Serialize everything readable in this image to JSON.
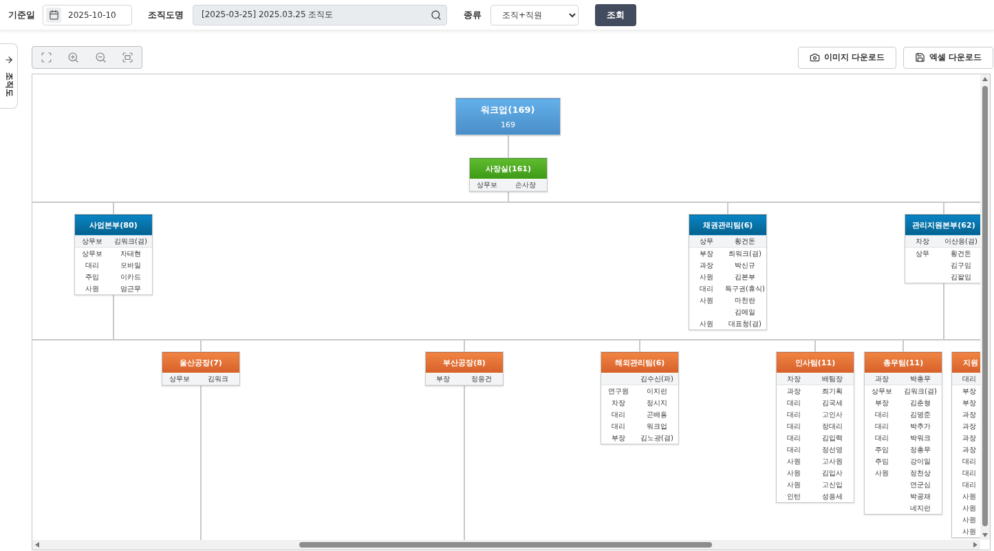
{
  "filters": {
    "date": {
      "label": "기준일",
      "value": "2025-10-10"
    },
    "chart_name": {
      "label": "조직도명",
      "value": "[2025-03-25] 2025.03.25 조직도"
    },
    "type": {
      "label": "종류",
      "value": "조직+직원"
    },
    "search_button": "조회"
  },
  "side_tab": {
    "label": "조직도"
  },
  "downloads": [
    {
      "kind": "image",
      "label": "이미지 다운로드"
    },
    {
      "kind": "excel",
      "label": "엑셀 다운로드"
    }
  ],
  "org_chart": {
    "kind": "root",
    "title": "워크업(169)",
    "subtitle": "169",
    "children": [
      {
        "kind": "office",
        "title": "사장실(161)",
        "head": {
          "position": "상무보",
          "name": "손사장"
        },
        "children": [
          {
            "kind": "division",
            "title": "사업본부(80)",
            "head": {
              "position": "상무보",
              "name": "김워크(겸)"
            },
            "members": [
              {
                "position": "상무보",
                "name": "차태현"
              },
              {
                "position": "대리",
                "name": "모바일"
              },
              {
                "position": "주임",
                "name": "이카드"
              },
              {
                "position": "사원",
                "name": "엄근무"
              }
            ],
            "children": [
              {
                "kind": "team",
                "title": "울산공장(7)",
                "head": {
                  "position": "상무보",
                  "name": "김워크"
                }
              },
              {
                "kind": "team",
                "title": "부산공장(8)",
                "head": {
                  "position": "부장",
                  "name": "정응건"
                }
              },
              {
                "kind": "team",
                "title": "해외관리팀(6)",
                "head": {
                  "name": "김수신(파)"
                },
                "members": [
                  {
                    "position": "연구원",
                    "name": "이지런"
                  },
                  {
                    "position": "차장",
                    "name": "정시지"
                  },
                  {
                    "position": "대리",
                    "name": "곤배용"
                  },
                  {
                    "position": "대리",
                    "name": "워크업"
                  },
                  {
                    "position": "부장",
                    "name": "김노광(겸)"
                  }
                ]
              }
            ]
          },
          {
            "kind": "division",
            "title": "채권관리팀(6)",
            "head": {
              "position": "상무",
              "name": "황건돈"
            },
            "members": [
              {
                "position": "부장",
                "name": "최워크(겸)"
              },
              {
                "position": "과장",
                "name": "박신규"
              },
              {
                "position": "사원",
                "name": "김본부"
              },
              {
                "position": "대리",
                "name": "득구권(휴식)"
              },
              {
                "position": "사원",
                "name": "마천란"
              },
              {
                "name": "김메일"
              },
              {
                "position": "사원",
                "name": "대표청(겸)"
              }
            ]
          },
          {
            "kind": "division",
            "title": "관리지원본부(62)",
            "head": {
              "position": "차장",
              "name": "이산응(겸)"
            },
            "members": [
              {
                "position": "상무",
                "name": "황건돈"
              },
              {
                "name": "김구임"
              },
              {
                "name": "김팔임"
              }
            ],
            "children": [
              {
                "kind": "team",
                "title": "인사팀(11)",
                "head": {
                  "position": "차장",
                  "name": "배팀장"
                },
                "members": [
                  {
                    "position": "과장",
                    "name": "최기획"
                  },
                  {
                    "position": "대리",
                    "name": "김국세"
                  },
                  {
                    "position": "대리",
                    "name": "고인사"
                  },
                  {
                    "position": "대리",
                    "name": "정대리"
                  },
                  {
                    "position": "대리",
                    "name": "김입력"
                  },
                  {
                    "position": "대리",
                    "name": "정선영"
                  },
                  {
                    "position": "사원",
                    "name": "고사원"
                  },
                  {
                    "position": "사원",
                    "name": "김입사"
                  },
                  {
                    "position": "사원",
                    "name": "고신입"
                  },
                  {
                    "position": "인턴",
                    "name": "성응세"
                  }
                ]
              },
              {
                "kind": "team",
                "title": "총무팀(11)",
                "head": {
                  "position": "과장",
                  "name": "박총무"
                },
                "members": [
                  {
                    "position": "상무보",
                    "name": "김워크(겸)"
                  },
                  {
                    "position": "부장",
                    "name": "김춘형"
                  },
                  {
                    "position": "대리",
                    "name": "김명준"
                  },
                  {
                    "position": "대리",
                    "name": "박추가"
                  },
                  {
                    "position": "대리",
                    "name": "박워크"
                  },
                  {
                    "position": "주임",
                    "name": "정총무"
                  },
                  {
                    "position": "주임",
                    "name": "강이일"
                  },
                  {
                    "position": "사원",
                    "name": "정천상"
                  },
                  {
                    "name": "연군심"
                  },
                  {
                    "name": "박공채"
                  },
                  {
                    "name": "네지런"
                  }
                ]
              },
              {
                "kind": "team",
                "title": "지원",
                "head": {
                  "position": "대리"
                },
                "members": [
                  {
                    "position": "부장"
                  },
                  {
                    "position": "부장"
                  },
                  {
                    "position": "과장"
                  },
                  {
                    "position": "과장"
                  },
                  {
                    "position": "과장"
                  },
                  {
                    "position": "과장"
                  },
                  {
                    "position": "대리"
                  },
                  {
                    "position": "대리"
                  },
                  {
                    "position": "대리"
                  },
                  {
                    "position": "사원"
                  },
                  {
                    "position": "사원"
                  },
                  {
                    "position": "사원"
                  },
                  {
                    "position": "사원"
                  }
                ]
              }
            ]
          }
        ]
      }
    ]
  }
}
